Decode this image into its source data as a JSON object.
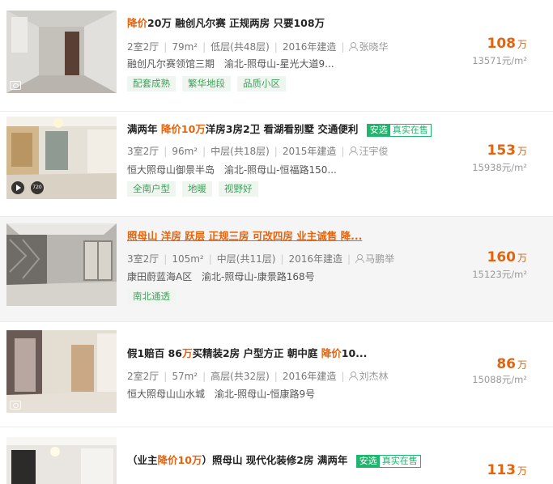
{
  "listings": [
    {
      "title_parts": [
        {
          "t": "降价",
          "hl": true
        },
        {
          "t": "20万 融创凡尔赛 正规两房 只要108万",
          "hl": false
        }
      ],
      "layout": "2室2厅",
      "area": "79m²",
      "floor": "低层(共48层)",
      "year": "2016年建造",
      "agent": "张晓华",
      "community": "融创凡尔赛领馆三期",
      "location": "渝北-照母山-星光大道9...",
      "features": [
        "配套成熟",
        "繁华地段",
        "品质小区"
      ],
      "price": "108",
      "price_unit": "万",
      "unit_price": "13571元/m²"
    },
    {
      "title_parts": [
        {
          "t": "满两年 ",
          "hl": false
        },
        {
          "t": "降价",
          "hl": true
        },
        {
          "t": "10万",
          "hl": true
        },
        {
          "t": "洋房3房2卫 看湖看别墅 交通便利",
          "hl": false
        }
      ],
      "tag": {
        "a": "安选",
        "b": "真实在售"
      },
      "video_badge": "720",
      "layout": "3室2厅",
      "area": "96m²",
      "floor": "中层(共18层)",
      "year": "2015年建造",
      "agent": "汪宇俊",
      "community": "恒大照母山御景半岛",
      "location": "渝北-照母山-恒福路150...",
      "features": [
        "全南户型",
        "地暖",
        "视野好"
      ],
      "price": "153",
      "price_unit": "万",
      "unit_price": "15938元/m²"
    },
    {
      "title_text": "照母山 洋房 跃层 正规三房 可改四房 业主诚售 降...",
      "layout": "3室2厅",
      "area": "105m²",
      "floor": "中层(共11层)",
      "year": "2016年建造",
      "agent": "马鹏举",
      "community": "康田蔚蓝海A区",
      "location": "渝北-照母山-康景路168号",
      "features": [
        "南北通透"
      ],
      "price": "160",
      "price_unit": "万",
      "unit_price": "15123元/m²"
    },
    {
      "title_parts": [
        {
          "t": "假1赔百 86",
          "hl": false
        },
        {
          "t": "万",
          "hl": true
        },
        {
          "t": "买精装2房 户型方正 朝中庭 ",
          "hl": false
        },
        {
          "t": "降价",
          "hl": true
        },
        {
          "t": "10...",
          "hl": false
        }
      ],
      "layout": "2室2厅",
      "area": "57m²",
      "floor": "高层(共32层)",
      "year": "2016年建造",
      "agent": "刘杰林",
      "community": "恒大照母山山水城",
      "location": "渝北-照母山-恒康路9号",
      "price": "86",
      "price_unit": "万",
      "unit_price": "15088元/m²"
    },
    {
      "title_parts": [
        {
          "t": "（业主",
          "hl": false
        },
        {
          "t": "降价",
          "hl": true
        },
        {
          "t": "10万",
          "hl": true
        },
        {
          "t": "）照母山 现代化装修2房 满两年",
          "hl": false
        }
      ],
      "tag": {
        "a": "安选",
        "b": "真实在售"
      },
      "price": "113",
      "price_unit": "万"
    }
  ],
  "colors": {
    "accent": "#e4640e",
    "tag_green": "#1db66c",
    "feature_bg": "#eef6ef",
    "hover_bg": "#f5f5f5"
  }
}
